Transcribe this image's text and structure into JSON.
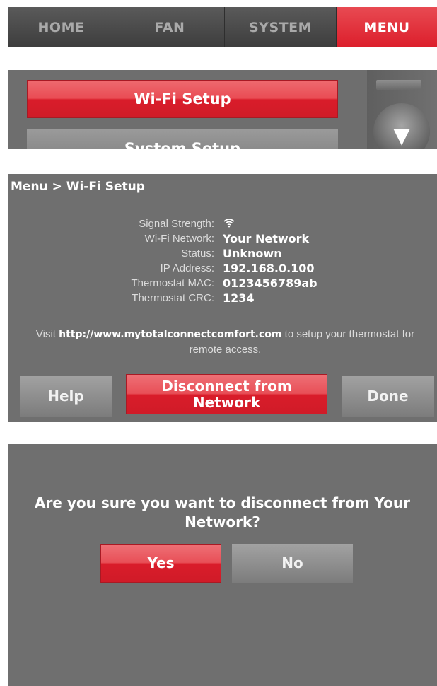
{
  "tabs": [
    {
      "label": "HOME",
      "active": false
    },
    {
      "label": "FAN",
      "active": false
    },
    {
      "label": "SYSTEM",
      "active": false
    },
    {
      "label": "MENU",
      "active": true
    }
  ],
  "menu": {
    "items": [
      "Wi-Fi Setup",
      "System Setup"
    ],
    "selected": "Wi-Fi Setup",
    "scroll_down_icon": "triangle-down"
  },
  "wifi_setup": {
    "breadcrumb": "Menu > Wi-Fi Setup",
    "info": [
      {
        "label": "Signal Strength:",
        "value": ""
      },
      {
        "label": "Wi-Fi Network:",
        "value": "Your Network"
      },
      {
        "label": "Status:",
        "value": "Unknown"
      },
      {
        "label": "IP Address:",
        "value": "192.168.0.100"
      },
      {
        "label": "Thermostat MAC:",
        "value": "0123456789ab"
      },
      {
        "label": "Thermostat CRC:",
        "value": "1234"
      }
    ],
    "signal_icon": "wifi-icon",
    "visit_prefix": "Visit ",
    "visit_url": "http://www.mytotalconnectcomfort.com",
    "visit_suffix": " to setup your thermostat for remote access.",
    "help_label": "Help",
    "disconnect_label": "Disconnect from Network",
    "done_label": "Done"
  },
  "confirm": {
    "question": "Are you sure you want to disconnect from Your Network?",
    "yes_label": "Yes",
    "no_label": "No"
  },
  "colors": {
    "accent_red": "#dc1e2b",
    "panel_gray": "#6f6f6f",
    "tab_gray": "#4a4a4a"
  }
}
